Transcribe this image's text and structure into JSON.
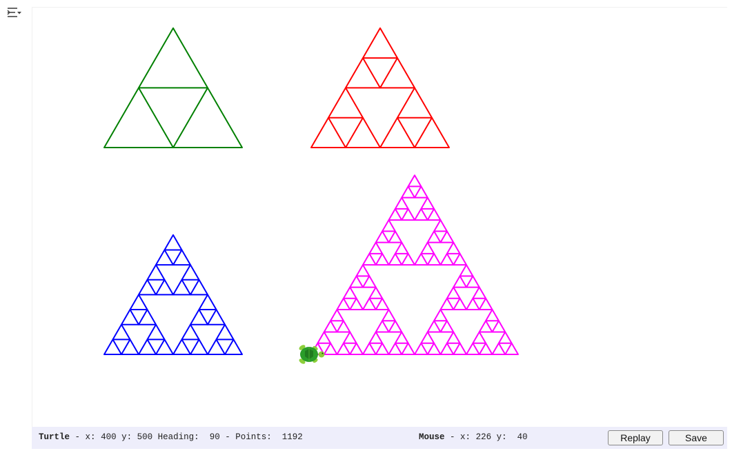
{
  "toolbar": {
    "menu_icon": "collapse-output-icon"
  },
  "canvas": {
    "background": "#ffffff",
    "triangles": [
      {
        "name": "green",
        "color": "#008000",
        "depth": 1,
        "base_left": [
          150,
          213
        ],
        "size": 200
      },
      {
        "name": "red",
        "color": "#ff0000",
        "depth": 2,
        "base_left": [
          450,
          213
        ],
        "size": 200
      },
      {
        "name": "blue",
        "color": "#0000ff",
        "depth": 3,
        "base_left": [
          150,
          513
        ],
        "size": 200
      },
      {
        "name": "magenta",
        "color": "#ff00ff",
        "depth": 4,
        "base_left": [
          450,
          513
        ],
        "size": 300
      }
    ],
    "turtle": {
      "icon": "turtle-icon",
      "color": "#2a9d2a"
    }
  },
  "status": {
    "turtle_label": "Turtle",
    "x_label": "x:",
    "x": "400",
    "y_label": "y:",
    "y": "500",
    "heading_label": "Heading:",
    "heading": "90",
    "points_label": "Points:",
    "points": "1192",
    "mouse_label": "Mouse",
    "mouse_x": "226",
    "mouse_y": "40"
  },
  "buttons": {
    "replay_label": "Replay",
    "save_label": "Save"
  }
}
